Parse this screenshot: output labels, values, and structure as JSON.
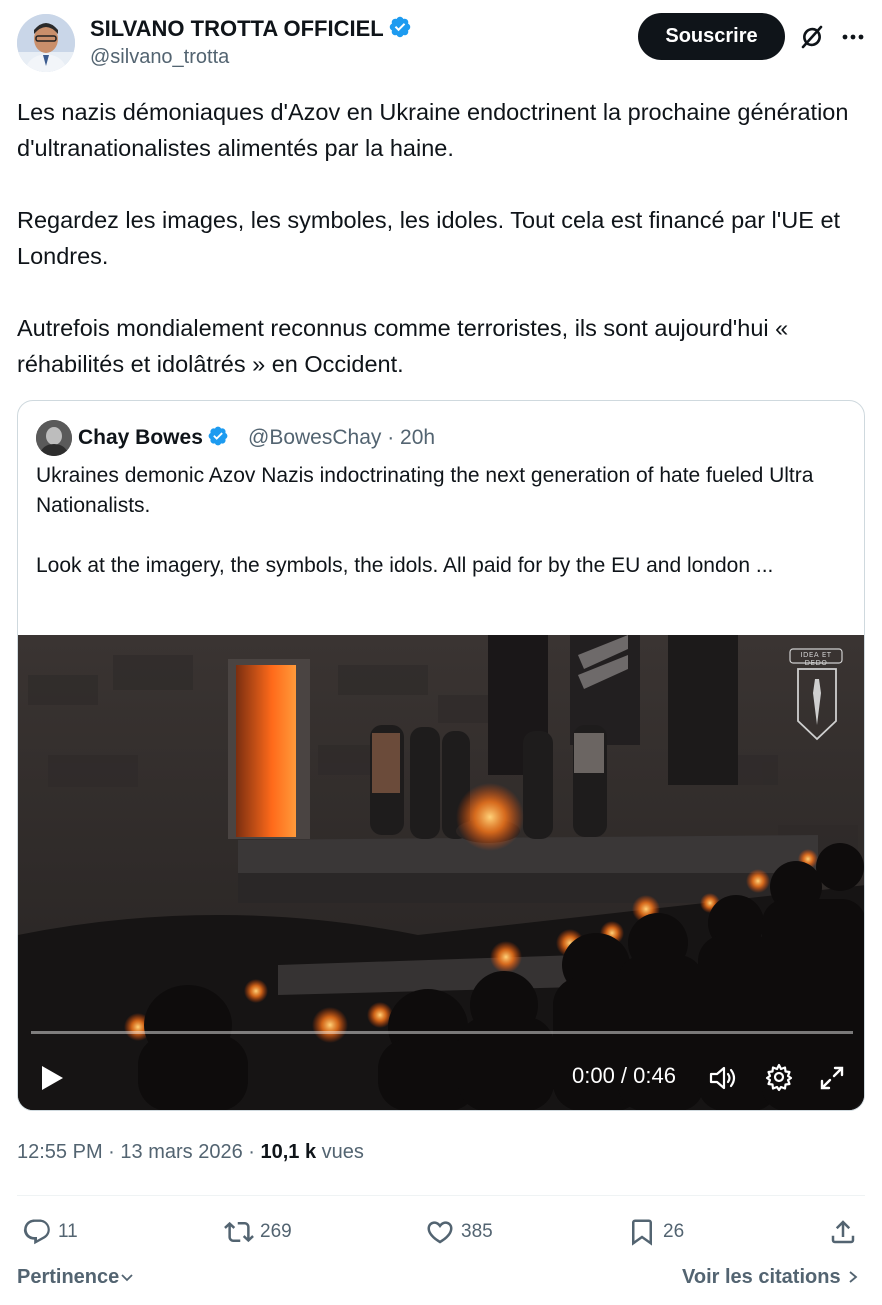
{
  "author": {
    "name": "SILVANO TROTTA OFFICIEL",
    "handle": "@silvano_trotta",
    "verified": true
  },
  "header": {
    "subscribe_label": "Souscrire",
    "grok_icon": "grok-icon",
    "more_icon": "more-icon"
  },
  "tweet": {
    "paragraphs": [
      "Les nazis démoniaques d'Azov en Ukraine endoctrinent la prochaine génération d'ultranationalistes alimentés par la haine.",
      "Regardez les images, les symboles, les idoles. Tout cela est financé par l'UE et Londres.",
      "Autrefois mondialement reconnus comme terroristes, ils sont aujourd'hui « réhabilités et idolâtrés » en Occident."
    ]
  },
  "quote": {
    "name": "Chay Bowes",
    "handle": "@BowesChay",
    "time": "20h",
    "paragraphs": [
      "Ukraines demonic Azov Nazis indoctrinating the next generation of hate fueled Ultra Nationalists.",
      "Look at the imagery, the symbols, the idols. All paid for by the EU and london ..."
    ],
    "video": {
      "time_display": "0:00 / 0:46",
      "progress": 0,
      "watermark_text": "IDEA ET DEDO"
    }
  },
  "meta": {
    "time": "12:55 PM",
    "separator": " · ",
    "date": "13 mars 2026",
    "views_count": "10,1 k",
    "views_label": "vues"
  },
  "actions": {
    "replies": "11",
    "reposts": "269",
    "likes": "385",
    "bookmarks": "26"
  },
  "footer": {
    "sort_label": "Pertinence",
    "quotes_label": "Voir les citations"
  },
  "colors": {
    "text": "#0f1419",
    "secondary": "#536471",
    "verified": "#1d9bf0",
    "button_bg": "#0f1419",
    "border": "#cfd9de"
  }
}
